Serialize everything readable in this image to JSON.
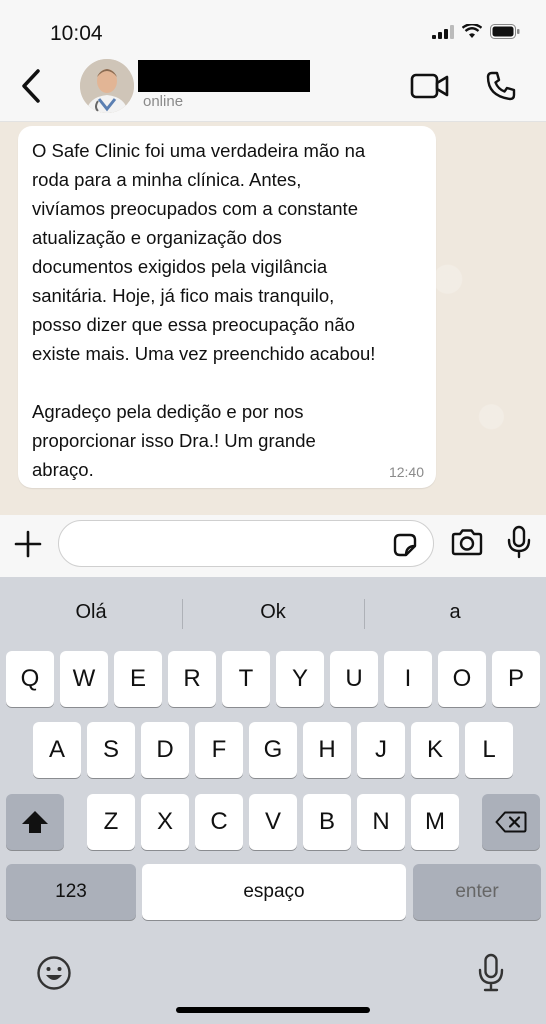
{
  "status_bar": {
    "time": "10:04"
  },
  "header": {
    "contact_status": "online"
  },
  "message": {
    "text": "O Safe Clinic foi uma verdadeira mão na\nroda para a minha clínica. Antes,\nvivíamos preocupados com a constante\natualização e organização dos\ndocumentos exigidos pela vigilância\nsanitária. Hoje, já fico mais tranquilo,\nposso dizer que essa preocupação não\nexiste mais. Uma vez preenchido acabou!\n\nAgradeço pela dedição e por nos\nproporcionar isso Dra.! Um grande\nabraço.",
    "time": "12:40"
  },
  "input": {
    "placeholder": ""
  },
  "keyboard": {
    "suggestions": [
      "Olá",
      "Ok",
      "a"
    ],
    "row1": [
      "Q",
      "W",
      "E",
      "R",
      "T",
      "Y",
      "U",
      "I",
      "O",
      "P"
    ],
    "row2": [
      "A",
      "S",
      "D",
      "F",
      "G",
      "H",
      "J",
      "K",
      "L"
    ],
    "row3": [
      "Z",
      "X",
      "C",
      "V",
      "B",
      "N",
      "M"
    ],
    "numbers_label": "123",
    "space_label": "espaço",
    "enter_label": "enter"
  },
  "icons": {
    "back": "chevron-left-icon",
    "video": "video-camera-icon",
    "phone": "phone-icon",
    "plus": "plus-icon",
    "sticker": "sticker-icon",
    "camera": "camera-icon",
    "mic": "microphone-icon",
    "shift": "shift-icon",
    "delete": "backspace-icon",
    "emoji": "emoji-icon",
    "dictation": "microphone-icon"
  }
}
